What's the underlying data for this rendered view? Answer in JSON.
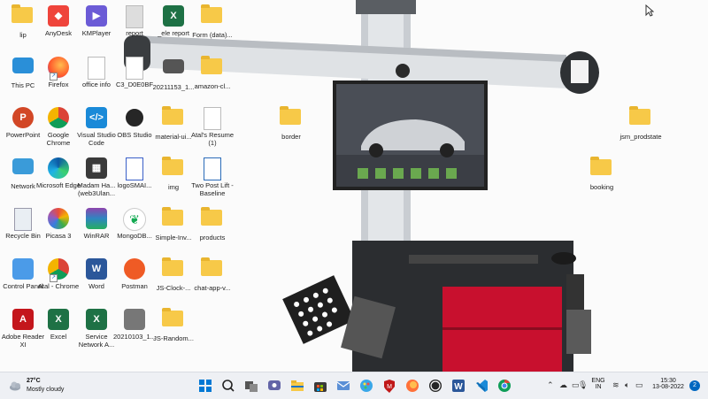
{
  "desktop_icons": [
    {
      "label": "lip",
      "icon": "folder-icon"
    },
    {
      "label": "AnyDesk",
      "icon": "anydesk-icon"
    },
    {
      "label": "KMPlayer",
      "icon": "kmplayer-icon"
    },
    {
      "label": "report",
      "icon": "document-icon"
    },
    {
      "label": "_ele report",
      "icon": "excel-file-icon"
    },
    {
      "label": "Form (data)...",
      "icon": "folder-icon"
    },
    {
      "label": "This PC",
      "icon": "this-pc-icon"
    },
    {
      "label": "Firefox",
      "icon": "firefox-icon"
    },
    {
      "label": "office info",
      "icon": "document-icon"
    },
    {
      "label": "C3_D0E0BF",
      "icon": "document-icon"
    },
    {
      "label": "20211153_1...",
      "icon": "image-file-icon"
    },
    {
      "label": "amazon-cl...",
      "icon": "folder-icon"
    },
    {
      "label": "PowerPoint",
      "icon": "powerpoint-icon"
    },
    {
      "label": "Google Chrome",
      "icon": "chrome-icon"
    },
    {
      "label": "Visual Studio Code",
      "icon": "vscode-icon"
    },
    {
      "label": "OBS Studio",
      "icon": "obs-icon"
    },
    {
      "label": "material-ui...",
      "icon": "folder-icon"
    },
    {
      "label": "Atal's Resume (1)",
      "icon": "document-icon"
    },
    {
      "label": "Network",
      "icon": "network-icon"
    },
    {
      "label": "Microsoft Edge",
      "icon": "edge-icon"
    },
    {
      "label": "Madam Ha... (web3Ulan...",
      "icon": "video-file-icon"
    },
    {
      "label": "logoSMAI...",
      "icon": "image-file-icon"
    },
    {
      "label": "img",
      "icon": "folder-icon"
    },
    {
      "label": "Two Post Lift - Baseline",
      "icon": "image-file-icon"
    },
    {
      "label": "Recycle Bin",
      "icon": "recycle-bin-icon"
    },
    {
      "label": "Picasa 3",
      "icon": "picasa-icon"
    },
    {
      "label": "WinRAR",
      "icon": "winrar-icon"
    },
    {
      "label": "MongoDB...",
      "icon": "mongodb-icon"
    },
    {
      "label": "Simple-Inv...",
      "icon": "folder-icon"
    },
    {
      "label": "products",
      "icon": "folder-icon"
    },
    {
      "label": "Control Panel",
      "icon": "control-panel-icon"
    },
    {
      "label": "Atal - Chrome",
      "icon": "chrome-icon"
    },
    {
      "label": "Word",
      "icon": "word-icon"
    },
    {
      "label": "Postman",
      "icon": "postman-icon"
    },
    {
      "label": "JS-Clock-...",
      "icon": "folder-icon"
    },
    {
      "label": "chat-app-v...",
      "icon": "folder-icon"
    },
    {
      "label": "Adobe Reader XI",
      "icon": "adobe-reader-icon"
    },
    {
      "label": "Excel",
      "icon": "excel-icon"
    },
    {
      "label": "Service Network A...",
      "icon": "excel-file-icon"
    },
    {
      "label": "20210103_1...",
      "icon": "image-file-icon"
    },
    {
      "label": "JS-Random...",
      "icon": "folder-icon"
    },
    {
      "label": "border",
      "icon": "folder-icon"
    },
    {
      "label": "jsm_prodstate",
      "icon": "folder-icon"
    },
    {
      "label": "booking",
      "icon": "folder-icon"
    }
  ],
  "taskbar": {
    "weather_temp": "27°C",
    "weather_desc": "Mostly cloudy",
    "lang_top": "ENG",
    "lang_bottom": "IN",
    "time": "15:30",
    "date": "13-08-2022",
    "apps": [
      "start-icon",
      "search-icon",
      "task-view-icon",
      "chat-icon",
      "file-explorer-icon",
      "microsoft-store-icon",
      "mail-icon",
      "paint-icon",
      "mcafee-icon",
      "firefox-icon",
      "obs-icon",
      "word-icon",
      "vscode-icon",
      "chrome-icon"
    ]
  },
  "colors": {
    "taskbar_bg": "#eef0f4",
    "folder": "#f7c948",
    "accent": "#0067c0"
  }
}
